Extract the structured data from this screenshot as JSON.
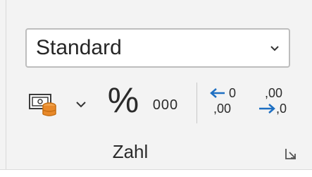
{
  "number_group": {
    "format_select": {
      "value": "Standard",
      "icon": "chevron-down-icon"
    },
    "buttons": {
      "accounting_icon": "accounting-number-format-icon",
      "accounting_dropdown_icon": "chevron-down-icon",
      "percent_label": "%",
      "comma_label": "000",
      "increase_decimal": {
        "top": "←0",
        "bottom": ",00",
        "icon": "increase-decimal-icon"
      },
      "decrease_decimal": {
        "top": ",00",
        "bottom": "→,0",
        "icon": "decrease-decimal-icon"
      }
    },
    "label": "Zahl",
    "launcher_icon": "dialog-launcher-icon"
  },
  "colors": {
    "accent_blue": "#1e6fc2",
    "coin_orange": "#e8892a",
    "panel_bg": "#f3f3f3"
  }
}
